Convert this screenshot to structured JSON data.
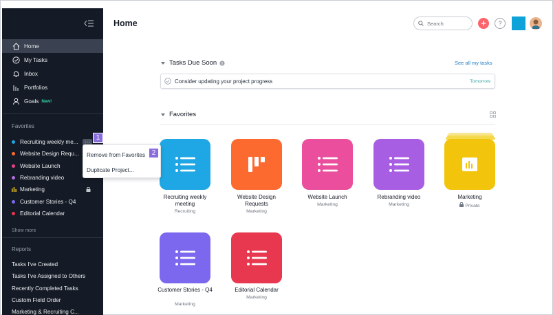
{
  "sidebar": {
    "nav": [
      {
        "label": "Home",
        "icon": "home-icon",
        "active": true
      },
      {
        "label": "My Tasks",
        "icon": "check-circle-icon"
      },
      {
        "label": "Inbox",
        "icon": "bell-icon"
      },
      {
        "label": "Portfolios",
        "icon": "bar-chart-icon"
      },
      {
        "label": "Goals",
        "icon": "person-icon",
        "badge": "New!"
      }
    ],
    "favorites_title": "Favorites",
    "favorites": [
      {
        "label": "Recruiting weekly me...",
        "color": "#1ea7e4"
      },
      {
        "label": "Website Design Requ...",
        "color": "#fc6a2f"
      },
      {
        "label": "Website Launch",
        "color": "#e83e8c"
      },
      {
        "label": "Rebranding video",
        "color": "#b46ee2"
      },
      {
        "label": "Marketing",
        "color": "#f0c419"
      },
      {
        "label": "Customer Stories - Q4",
        "color": "#7a6bf0"
      },
      {
        "label": "Editorial Calendar",
        "color": "#e8344e"
      }
    ],
    "show_more": "Show more",
    "reports_title": "Reports",
    "reports": [
      "Tasks I've Created",
      "Tasks I've Assigned to Others",
      "Recently Completed Tasks",
      "Custom Field Order",
      "Marketing & Recruiting C..."
    ]
  },
  "context_menu": {
    "items": [
      "Remove from Favorites",
      "Duplicate Project..."
    ],
    "more_glyph": "···"
  },
  "callouts": {
    "one": "1",
    "two": "2"
  },
  "header": {
    "title": "Home",
    "search_placeholder": "Search",
    "plus": "+",
    "help": "?"
  },
  "tasks_due": {
    "title": "Tasks Due Soon",
    "link": "See all my tasks",
    "task": "Consider updating your project progress",
    "due": "Tomorrow"
  },
  "favorites_section": {
    "title": "Favorites",
    "projects": [
      {
        "name": "Recruiting weekly meeting",
        "team": "Recruiting",
        "color": "#1ea7e4",
        "icon": "list-icon"
      },
      {
        "name": "Website Design Requests",
        "team": "Marketing",
        "color": "#fc6a2f",
        "icon": "board-icon"
      },
      {
        "name": "Website Launch",
        "team": "Marketing",
        "color": "#ea4e9d",
        "icon": "list-icon"
      },
      {
        "name": "Rebranding video",
        "team": "Marketing",
        "color": "#a85ee3",
        "icon": "list-icon"
      },
      {
        "name": "Marketing",
        "team": "Private",
        "color": "#f2c40b",
        "icon": "portfolio-icon"
      },
      {
        "name": "Customer Stories - Q4",
        "team": "Marketing",
        "color": "#7b68ee",
        "icon": "list-icon"
      },
      {
        "name": "Editorial Calendar",
        "team": "Marketing",
        "color": "#e8384f",
        "icon": "list-icon"
      }
    ]
  }
}
